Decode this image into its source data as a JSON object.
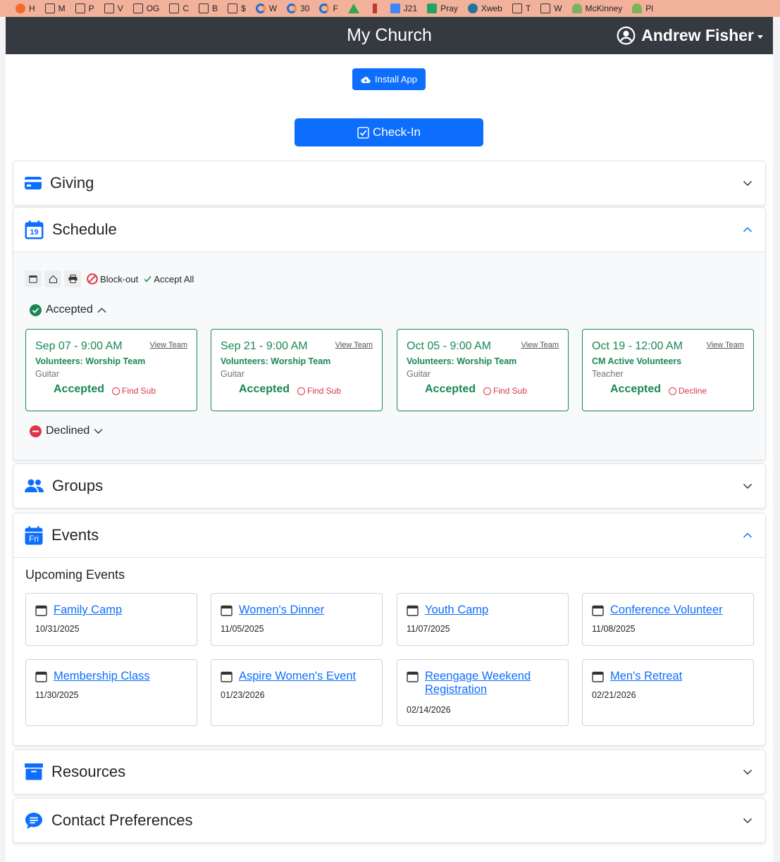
{
  "bookmarks": [
    {
      "label": "H",
      "icon": "orange-app-icon"
    },
    {
      "label": "M",
      "icon": "folder-icon"
    },
    {
      "label": "P",
      "icon": "folder-icon"
    },
    {
      "label": "V",
      "icon": "folder-icon"
    },
    {
      "label": "OG",
      "icon": "folder-icon"
    },
    {
      "label": "C",
      "icon": "folder-icon"
    },
    {
      "label": "B",
      "icon": "folder-icon"
    },
    {
      "label": "$",
      "icon": "folder-icon"
    },
    {
      "label": "W",
      "icon": "c-logo-icon"
    },
    {
      "label": "30",
      "icon": "c-logo-icon"
    },
    {
      "label": "F",
      "icon": "c-logo-icon"
    },
    {
      "label": "",
      "icon": "google-drive-icon"
    },
    {
      "label": "",
      "icon": "red-mark-icon"
    },
    {
      "label": "J21",
      "icon": "google-docs-icon"
    },
    {
      "label": "Pray",
      "icon": "google-sheets-icon"
    },
    {
      "label": "Xweb",
      "icon": "wordpress-icon"
    },
    {
      "label": "T",
      "icon": "folder-icon"
    },
    {
      "label": "W",
      "icon": "folder-icon"
    },
    {
      "label": "McKinney",
      "icon": "plant-icon"
    },
    {
      "label": "Pl",
      "icon": "plant-icon"
    }
  ],
  "navbar": {
    "brand": "My Church",
    "user_name": "Andrew Fisher"
  },
  "actions": {
    "install_label": "Install App",
    "checkin_label": "Check-In"
  },
  "sections": {
    "giving": "Giving",
    "schedule": "Schedule",
    "groups": "Groups",
    "events": "Events",
    "resources": "Resources",
    "contact": "Contact Preferences"
  },
  "schedule": {
    "toolbar": {
      "blockout_label": "Block-out",
      "accept_all_label": "Accept All"
    },
    "accepted_heading": "Accepted",
    "declined_heading": "Declined",
    "cards": [
      {
        "date": "Sep 07 - 9:00 AM",
        "view_team": "View Team",
        "team": "Volunteers: Worship Team",
        "position": "Guitar",
        "status": "Accepted",
        "action": "Find Sub"
      },
      {
        "date": "Sep 21 - 9:00 AM",
        "view_team": "View Team",
        "team": "Volunteers: Worship Team",
        "position": "Guitar",
        "status": "Accepted",
        "action": "Find Sub"
      },
      {
        "date": "Oct 05 - 9:00 AM",
        "view_team": "View Team",
        "team": "Volunteers: Worship Team",
        "position": "Guitar",
        "status": "Accepted",
        "action": "Find Sub"
      },
      {
        "date": "Oct 19 - 12:00 AM",
        "view_team": "View Team",
        "team": "CM Active Volunteers",
        "position": "Teacher",
        "status": "Accepted",
        "action": "Decline"
      }
    ]
  },
  "events": {
    "heading": "Upcoming Events",
    "icon_text": "Fri",
    "items": [
      {
        "name": "Family Camp",
        "date": "10/31/2025"
      },
      {
        "name": "Women's Dinner",
        "date": "11/05/2025"
      },
      {
        "name": "Youth Camp",
        "date": "11/07/2025"
      },
      {
        "name": "Conference Volunteer",
        "date": "11/08/2025"
      },
      {
        "name": "Membership Class",
        "date": "11/30/2025"
      },
      {
        "name": "Aspire Women's Event",
        "date": "01/23/2026"
      },
      {
        "name": "Reengage Weekend Registration",
        "date": "02/14/2026"
      },
      {
        "name": "Men's Retreat",
        "date": "02/21/2026"
      }
    ]
  },
  "schedule_icon_text": "19",
  "colors": {
    "primary": "#0d6efd",
    "success": "#198754",
    "danger": "#dc3545",
    "navbar": "#343a40",
    "bookmark_bar": "#f2b19b"
  }
}
